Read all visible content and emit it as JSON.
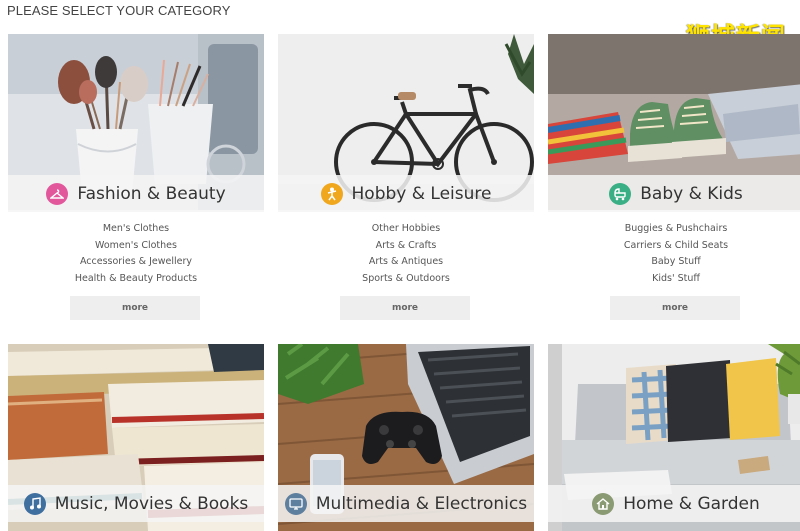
{
  "heading": "PLEASE SELECT YOUR CATEGORY",
  "watermark": "狮城新闻",
  "categories": [
    {
      "title": "Fashion & Beauty",
      "icon": "hanger-icon",
      "icon_color": "#e2579c",
      "subs": [
        "Men's Clothes",
        "Women's Clothes",
        "Accessories & Jewellery",
        "Health & Beauty Products"
      ],
      "more": "more"
    },
    {
      "title": "Hobby & Leisure",
      "icon": "person-leisure-icon",
      "icon_color": "#f0a71e",
      "subs": [
        "Other Hobbies",
        "Arts & Crafts",
        "Arts & Antiques",
        "Sports & Outdoors"
      ],
      "more": "more"
    },
    {
      "title": "Baby & Kids",
      "icon": "stroller-icon",
      "icon_color": "#3aaf86",
      "subs": [
        "Buggies & Pushchairs",
        "Carriers & Child Seats",
        "Baby Stuff",
        "Kids' Stuff"
      ],
      "more": "more"
    },
    {
      "title": "Music, Movies & Books",
      "icon": "music-icon",
      "icon_color": "#3f6f9f"
    },
    {
      "title": "Multimedia & Electronics",
      "icon": "monitor-icon",
      "icon_color": "#5f7f9f"
    },
    {
      "title": "Home & Garden",
      "icon": "house-icon",
      "icon_color": "#8a9a72"
    }
  ]
}
